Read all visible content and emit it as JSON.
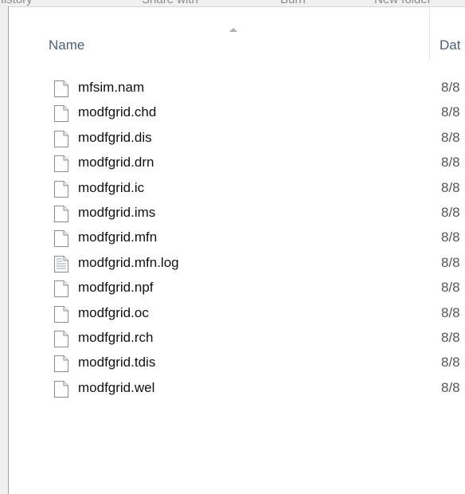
{
  "columns": {
    "name": "Name",
    "date": "Dat"
  },
  "icons": {
    "sort": "sort-ascending-arrow-icon",
    "file": "blank-file-icon",
    "text_file": "text-file-icon"
  },
  "files": [
    {
      "name": "mfsim.nam",
      "date": "8/8",
      "icon": "blank-file-icon"
    },
    {
      "name": "modfgrid.chd",
      "date": "8/8",
      "icon": "blank-file-icon"
    },
    {
      "name": "modfgrid.dis",
      "date": "8/8",
      "icon": "blank-file-icon"
    },
    {
      "name": "modfgrid.drn",
      "date": "8/8",
      "icon": "blank-file-icon"
    },
    {
      "name": "modfgrid.ic",
      "date": "8/8",
      "icon": "blank-file-icon"
    },
    {
      "name": "modfgrid.ims",
      "date": "8/8",
      "icon": "blank-file-icon"
    },
    {
      "name": "modfgrid.mfn",
      "date": "8/8",
      "icon": "blank-file-icon"
    },
    {
      "name": "modfgrid.mfn.log",
      "date": "8/8",
      "icon": "text-file-icon"
    },
    {
      "name": "modfgrid.npf",
      "date": "8/8",
      "icon": "blank-file-icon"
    },
    {
      "name": "modfgrid.oc",
      "date": "8/8",
      "icon": "blank-file-icon"
    },
    {
      "name": "modfgrid.rch",
      "date": "8/8",
      "icon": "blank-file-icon"
    },
    {
      "name": "modfgrid.tdis",
      "date": "8/8",
      "icon": "blank-file-icon"
    },
    {
      "name": "modfgrid.wel",
      "date": "8/8",
      "icon": "blank-file-icon"
    }
  ]
}
